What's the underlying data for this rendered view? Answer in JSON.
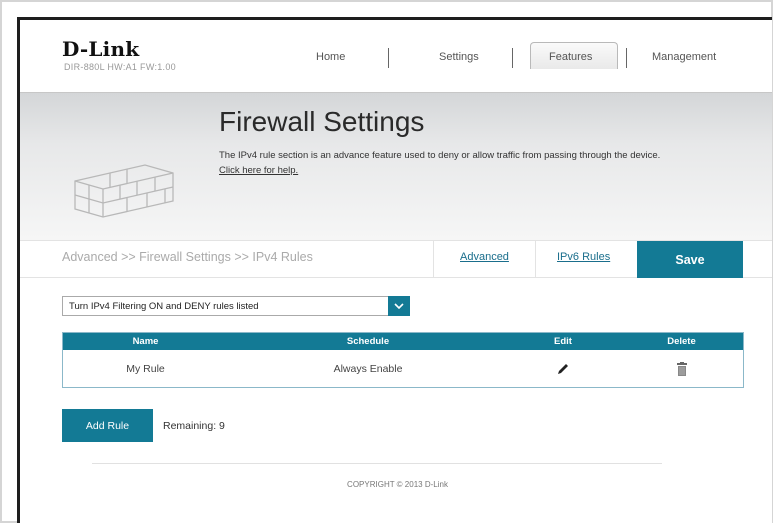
{
  "brand": {
    "logo": "D-Link",
    "model_line": "DIR-880L  HW:A1  FW:1.00"
  },
  "nav": {
    "items": [
      "Home",
      "Settings",
      "Features",
      "Management"
    ],
    "active": "Features"
  },
  "hero": {
    "title": "Firewall Settings",
    "description": "The IPv4 rule section is an advance feature used to deny or allow traffic from passing through the device.",
    "help_link": "Click here for help."
  },
  "breadcrumb": "Advanced >> Firewall Settings >> IPv4 Rules",
  "tabs": {
    "advanced": "Advanced",
    "ipv6": "IPv6 Rules",
    "save": "Save"
  },
  "filter": {
    "selected": "Turn IPv4 Filtering ON and DENY rules listed"
  },
  "table": {
    "headers": [
      "Name",
      "Schedule",
      "Edit",
      "Delete"
    ],
    "rows": [
      {
        "name": "My Rule",
        "schedule": "Always Enable"
      }
    ]
  },
  "add_rule": {
    "label": "Add Rule",
    "remaining": "Remaining: 9"
  },
  "footer": {
    "copyright": "COPYRIGHT © 2013 D-Link"
  },
  "colors": {
    "accent": "#137a95",
    "link": "#1a6e8c"
  },
  "icons": {
    "dropdown": "chevron-down-icon",
    "edit": "pencil-icon",
    "delete": "trash-icon",
    "hero": "brick-wall-icon"
  }
}
